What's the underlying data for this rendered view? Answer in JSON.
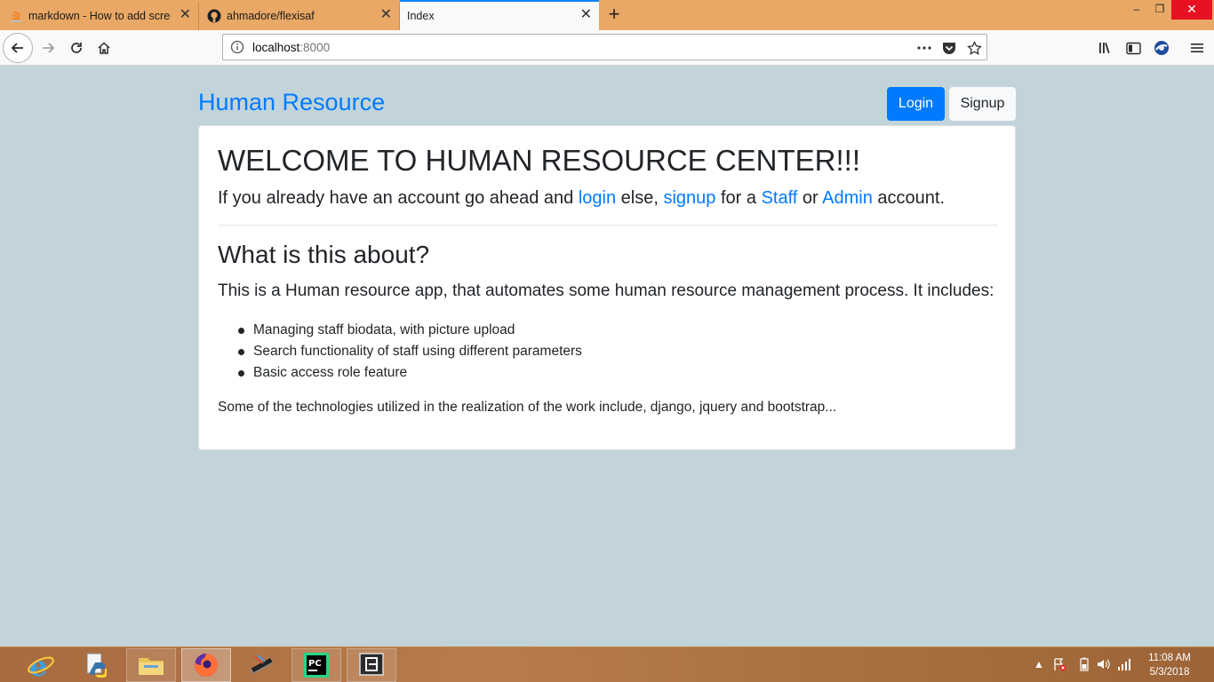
{
  "browser": {
    "tabs": [
      {
        "title": "markdown - How to add screenshot",
        "icon": "stackoverflow-icon",
        "active": false
      },
      {
        "title": "ahmadore/flexisaf",
        "icon": "github-icon",
        "active": false
      },
      {
        "title": "Index",
        "icon": "none",
        "active": true
      }
    ],
    "new_tab_label": "+",
    "url_host": "localhost",
    "url_port": ":8000",
    "window_controls": {
      "minimize": "–",
      "maximize": "❐",
      "close": "✕"
    }
  },
  "page": {
    "brand": "Human Resource",
    "login_label": "Login",
    "signup_label": "Signup",
    "heading": "WELCOME TO HUMAN RESOURCE CENTER!!!",
    "lead": {
      "part1": "If you already have an account go ahead and ",
      "login": "login",
      "part2": " else, ",
      "signup": "signup",
      "part3": " for a ",
      "staff": "Staff",
      "part4": " or ",
      "admin": "Admin",
      "part5": " account."
    },
    "subheading": "What is this about?",
    "description": "This is a Human resource app, that automates some human resource management process. It includes:",
    "features": [
      "Managing staff biodata, with picture upload",
      "Search functionality of staff using different parameters",
      "Basic access role feature"
    ],
    "closing": "Some of the technologies utilized in the realization of the work include, django, jquery and bootstrap..."
  },
  "taskbar": {
    "apps": [
      "internet-explorer-icon",
      "python-icon",
      "file-explorer-icon",
      "firefox-icon",
      "scanner-icon",
      "pycharm-icon",
      "editor-icon"
    ],
    "clock_time": "11:08 AM",
    "clock_date": "5/3/2018"
  },
  "colors": {
    "accent": "#007bff",
    "background": "#c2d4d9",
    "tabbar": "#e9a865"
  }
}
